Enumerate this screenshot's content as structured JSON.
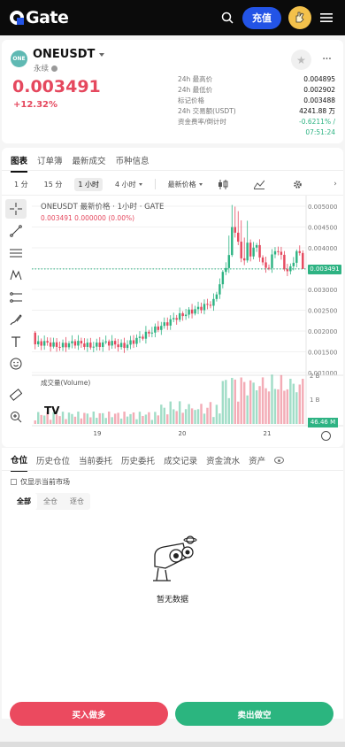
{
  "brand": {
    "name": "Gate"
  },
  "header": {
    "deposit_label": "充值"
  },
  "ticker": {
    "symbol": "ONEUSDT",
    "contract_type": "永续",
    "coin_badge": "ONE",
    "last_price": "0.003491",
    "change_pct": "+12.32%",
    "stats": [
      {
        "label": "24h 最高价",
        "value": "0.004895"
      },
      {
        "label": "24h 最低价",
        "value": "0.002902"
      },
      {
        "label": "标记价格",
        "value": "0.003488"
      },
      {
        "label": "24h 交易额(USDT)",
        "value": "4241.88 万"
      },
      {
        "label": "资金费率/倒计时",
        "value": "-0.6211% /"
      }
    ],
    "countdown": "07:51:24"
  },
  "chart_tabs": [
    "图表",
    "订单簿",
    "最新成交",
    "币种信息"
  ],
  "intervals": {
    "items": [
      "1 分",
      "15 分",
      "1 小时",
      "4 小时"
    ],
    "active_index": 2,
    "price_type": "最新价格"
  },
  "chart": {
    "title": "ONEUSDT 最新价格 · 1小时 · GATE",
    "last_line": "0.003491  0.000000 (0.00%)",
    "volume_title": "成交量(Volume)",
    "price_tag": "0.003491",
    "volume_tag": "46.46 M",
    "tv_logo": "TV",
    "colors": {
      "up": "#2eb383",
      "down": "#e5485e"
    }
  },
  "chart_data": {
    "type": "candlestick",
    "title": "ONEUSDT 最新价格 · 1小时 · GATE",
    "y_ticks": [
      "0.005000",
      "0.004500",
      "0.004000",
      "0.003500",
      "0.003000",
      "0.002500",
      "0.002000",
      "0.001500",
      "0.001000"
    ],
    "ylim": [
      0.001,
      0.005
    ],
    "x_ticks": [
      "19",
      "20",
      "21"
    ],
    "volume_ticks": [
      "2 B",
      "1 B"
    ],
    "last_price": 0.003491,
    "grid": true
  },
  "positions": {
    "tabs": [
      "仓位",
      "历史仓位",
      "当前委托",
      "历史委托",
      "成交记录",
      "资金流水",
      "资产"
    ],
    "only_current_label": "仅显示当前市场",
    "segments": [
      "全部",
      "全仓",
      "逐仓"
    ],
    "empty_text": "暂无数据"
  },
  "actions": {
    "buy_label": "买入做多",
    "sell_label": "卖出做空"
  }
}
